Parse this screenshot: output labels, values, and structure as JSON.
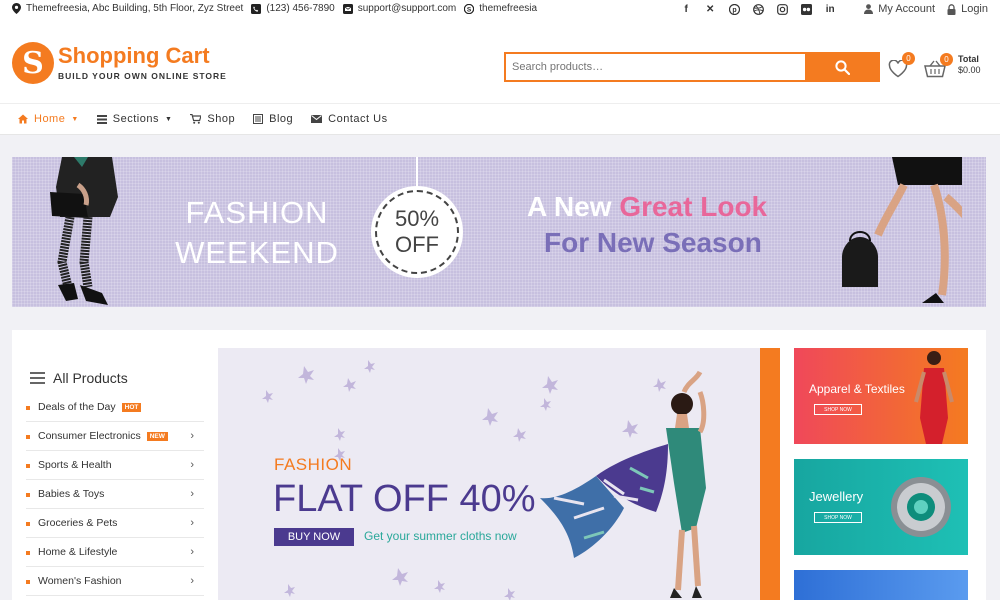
{
  "topbar": {
    "address": "Themefreesia, Abc Building, 5th Floor, Zyz Street",
    "phone": "(123) 456-7890",
    "email": "support@support.com",
    "skype": "themefreesia",
    "social": [
      "facebook-icon",
      "x-icon",
      "pinterest-icon",
      "dribbble-icon",
      "instagram-icon",
      "flickr-icon",
      "linkedin-icon"
    ],
    "my_account": "My Account",
    "login": "Login"
  },
  "header": {
    "logo_letter": "S",
    "site_title": "Shopping Cart",
    "tagline": "BUILD YOUR OWN ONLINE STORE",
    "search_placeholder": "Search products…",
    "wishlist_count": "0",
    "cart_count": "0",
    "total_label": "Total",
    "total_value": "$0.00"
  },
  "nav": {
    "items": [
      {
        "label": "Home",
        "active": true,
        "dropdown": true
      },
      {
        "label": "Sections",
        "active": false,
        "dropdown": true
      },
      {
        "label": "Shop",
        "active": false,
        "dropdown": false
      },
      {
        "label": "Blog",
        "active": false,
        "dropdown": false
      },
      {
        "label": "Contact Us",
        "active": false,
        "dropdown": false
      }
    ]
  },
  "promo": {
    "line1": "FASHION",
    "line2": "WEEKEND",
    "off_pct": "50%",
    "off_word": "OFF",
    "headline_a": "A New ",
    "headline_b": "Great Look",
    "headline_c": "For New Season"
  },
  "categories": {
    "title": "All Products",
    "items": [
      {
        "label": "Deals of the Day",
        "tag": "HOT",
        "chevron": false
      },
      {
        "label": "Consumer Electronics",
        "tag": "NEW",
        "chevron": true
      },
      {
        "label": "Sports & Health",
        "tag": "",
        "chevron": true
      },
      {
        "label": "Babies & Toys",
        "tag": "",
        "chevron": true
      },
      {
        "label": "Groceries & Pets",
        "tag": "",
        "chevron": true
      },
      {
        "label": "Home & Lifestyle",
        "tag": "",
        "chevron": true
      },
      {
        "label": "Women's Fashion",
        "tag": "",
        "chevron": true
      }
    ]
  },
  "slider": {
    "kicker": "FASHION",
    "headline": "FLAT OFF 40%",
    "button": "BUY NOW",
    "sub": "Get your summer cloths now"
  },
  "side_banners": [
    {
      "title": "Apparel & Textiles",
      "button": "SHOP NOW"
    },
    {
      "title": "Jewellery",
      "button": "SHOP NOW"
    }
  ],
  "colors": {
    "accent": "#f47b20",
    "purple": "#4b3a8f",
    "teal": "#2aa89a",
    "pink": "#e8679a"
  }
}
